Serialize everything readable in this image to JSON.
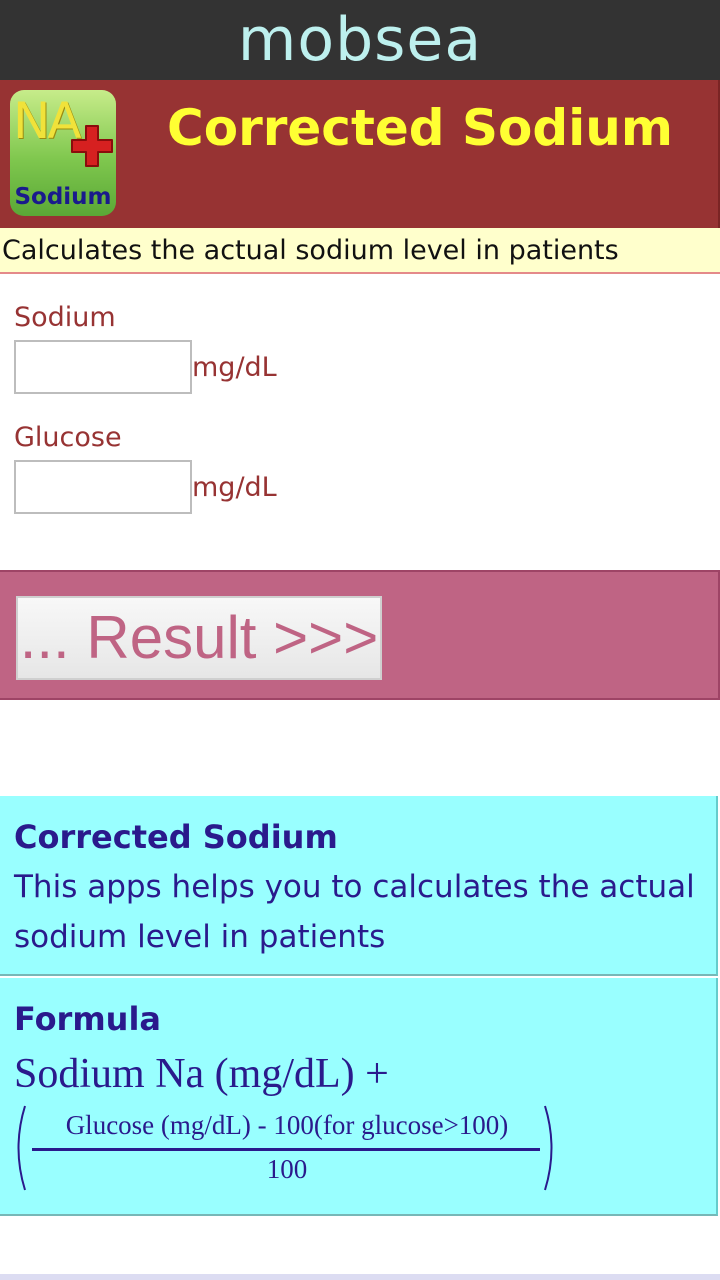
{
  "topbar": {
    "brand": "mobsea"
  },
  "header": {
    "icon_text_top": "NA",
    "icon_text_bottom": "Sodium",
    "title": "Corrected Sodium"
  },
  "subtitle": "Calculates the actual sodium level in patients",
  "form": {
    "sodium_label": "Sodium",
    "sodium_value": "",
    "sodium_unit": "mg/dL",
    "glucose_label": "Glucose",
    "glucose_value": "",
    "glucose_unit": "mg/dL"
  },
  "result_button": "... Result >>>",
  "about": {
    "title": "Corrected Sodium",
    "text": "This apps helps you to calculates the actual sodium level in patients"
  },
  "formula": {
    "title": "Formula",
    "line1": "Sodium Na (mg/dL) +",
    "numerator": "Glucose (mg/dL) - 100(for glucose>100)",
    "denominator": "100"
  },
  "colors": {
    "topbar": "#333333",
    "brand": "#bdf0ee",
    "header": "#973333",
    "header_title": "#ffff33",
    "subtitle_bg": "#ffffcc",
    "label": "#973333",
    "result_band": "#bf6484",
    "info_bg": "#99ffff",
    "info_text": "#2a1a8c"
  },
  "icons": {
    "app_icon": "sodium-app-icon",
    "cross": "red-medical-cross-icon"
  }
}
